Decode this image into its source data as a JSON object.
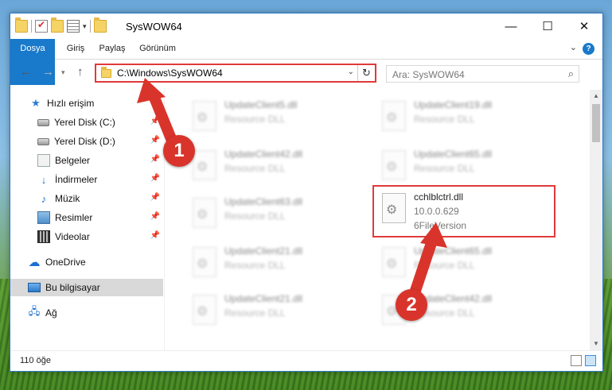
{
  "window": {
    "title": "SysWOW64",
    "controls": {
      "minimize": "—",
      "maximize": "☐",
      "close": "✕"
    }
  },
  "ribbon": {
    "tabs": [
      "Dosya",
      "Giriş",
      "Paylaş",
      "Görünüm"
    ],
    "help": "?"
  },
  "navbar": {
    "back": "←",
    "forward": "→",
    "up": "↑",
    "address": "C:\\Windows\\SysWOW64",
    "search_placeholder": "Ara: SysWOW64"
  },
  "sidebar": {
    "items": [
      {
        "label": "Hızlı erişim",
        "icon": "star-icon"
      },
      {
        "label": "Yerel Disk (C:)",
        "icon": "disk-icon",
        "pinned": true
      },
      {
        "label": "Yerel Disk (D:)",
        "icon": "disk-icon",
        "pinned": true
      },
      {
        "label": "Belgeler",
        "icon": "documents-icon",
        "pinned": true
      },
      {
        "label": "İndirmeler",
        "icon": "download-icon",
        "pinned": true
      },
      {
        "label": "Müzik",
        "icon": "music-icon",
        "pinned": true
      },
      {
        "label": "Resimler",
        "icon": "pictures-icon",
        "pinned": true
      },
      {
        "label": "Videolar",
        "icon": "videos-icon",
        "pinned": true
      },
      {
        "label": "OneDrive",
        "icon": "onedrive-icon"
      },
      {
        "label": "Bu bilgisayar",
        "icon": "computer-icon",
        "selected": true
      },
      {
        "label": "Ağ",
        "icon": "network-icon"
      }
    ]
  },
  "files": [
    {
      "name": "UpdateClient5.dll",
      "type": "Resource DLL"
    },
    {
      "name": "UpdateClient19.dll",
      "type": "Resource DLL"
    },
    {
      "name": "UpdateClient42.dll",
      "type": "Resource DLL"
    },
    {
      "name": "UpdateClient65.dll",
      "type": "Resource DLL"
    },
    {
      "name": "UpdateClient63.dll",
      "type": "Resource DLL"
    },
    {
      "name": "cchlblctrl.dll",
      "version": "10.0.0.629",
      "description": "6FileVersion"
    },
    {
      "name": "UpdateClient21.dll",
      "type": "Resource DLL"
    },
    {
      "name": "UpdateClient65.dll",
      "type": "Resource DLL"
    },
    {
      "name": "UpdateClient21.dll",
      "type": "Resource DLL"
    },
    {
      "name": "UpdateClient42.dll",
      "type": "Resource DLL"
    }
  ],
  "status": {
    "item_count": "110 öğe"
  },
  "annotations": {
    "step1": "1",
    "step2": "2",
    "color": "#d9342b"
  }
}
